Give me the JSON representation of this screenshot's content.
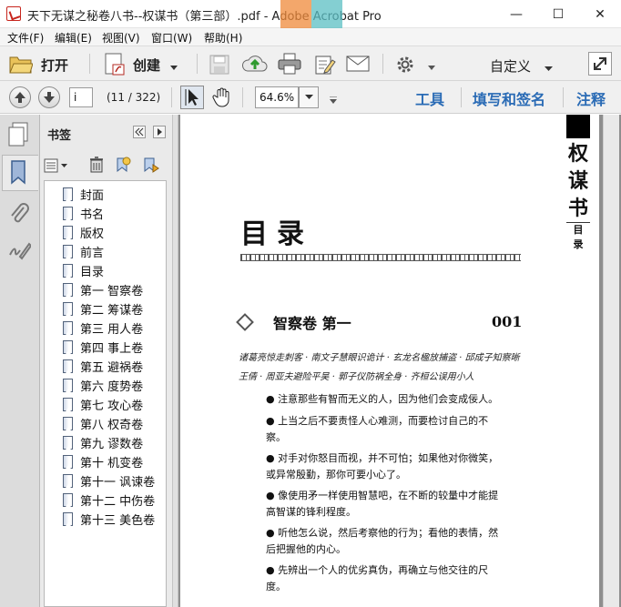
{
  "window": {
    "title": "天下无谋之秘卷八书--权谋书（第三部）.pdf - Adobe Acrobat Pro",
    "minimize": "—",
    "maximize": "☐",
    "close": "✕"
  },
  "menu": [
    "文件(F)",
    "编辑(E)",
    "视图(V)",
    "窗口(W)",
    "帮助(H)"
  ],
  "toolbar": {
    "open_label": "打开",
    "create_label": "创建",
    "customize_label": "自定义"
  },
  "nav": {
    "page_input": "i",
    "page_count": "(11 / 322)",
    "zoom": "64.6%",
    "tools_label": "工具",
    "fill_sign_label": "填写和签名",
    "comment_label": "注释"
  },
  "bookmarks": {
    "panel_title": "书签",
    "items": [
      "封面",
      "书名",
      "版权",
      "前言",
      "目录",
      "第一 智察卷",
      "第二 筹谋卷",
      "第三 用人卷",
      "第四 事上卷",
      "第五 避祸卷",
      "第六 度势卷",
      "第七 攻心卷",
      "第八 权奇卷",
      "第九 谬数卷",
      "第十 机变卷",
      "第十一 讽谏卷",
      "第十二 中伤卷",
      "第十三 美色卷"
    ]
  },
  "document": {
    "heading": "目录",
    "side_title": [
      "权",
      "谋",
      "书"
    ],
    "side_sub": [
      "目",
      "录"
    ],
    "chapter_title": "智察卷 第一",
    "chapter_page": "001",
    "sub_line1": "诸葛亮惊走刺客 · 南文子慧眼识诡计 · 玄龙名楹放捕盗 · 邱成子知察晰",
    "sub_line2": "王倩 · 周亚夫避险平吴 · 郭子仪防祸全身 · 齐桓公误用小人",
    "bullets": [
      "● 注意那些有智而无义的人，因为他们会变成佞人。",
      "● 上当之后不要责怪人心难测，而要检讨自己的不察。",
      "● 对手对你怒目而视，并不可怕；如果他对你微笑，或异常殷勤，那你可要小心了。",
      "● 像使用矛一样使用智慧吧，在不断的较量中才能提高智谋的锋利程度。",
      "● 听他怎么说，然后考察他的行为；看他的表情，然后把握他的内心。",
      "● 先辨出一个人的优劣真伪，再确立与他交往的尺度。"
    ]
  }
}
